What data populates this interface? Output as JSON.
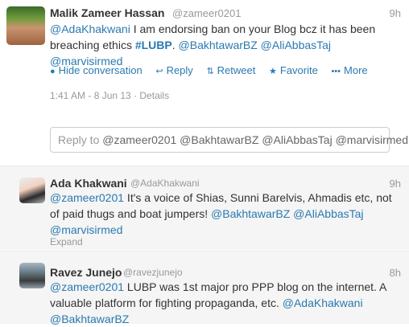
{
  "main_tweet": {
    "name": "Malik Zameer Hassan",
    "handle": "@zameer0201",
    "time": "9h",
    "text": {
      "mention1": "@AdaKhakwani",
      "body1": " I am endorsing ban on your Blog bcz it has been breaching ethics ",
      "hashtag": "#LUBP",
      "body2": ". ",
      "mention2": "@BakhtawarBZ",
      "mention3": "@AliAbbasTaj",
      "mention4": "@marvisirmed"
    },
    "actions": {
      "hide": "Hide conversation",
      "reply": "Reply",
      "retweet": "Retweet",
      "favorite": "Favorite",
      "more": "More"
    },
    "meta": "1:41 AM - 8 Jun 13 · Details"
  },
  "reply_box": {
    "label": "Reply to ",
    "mentions": "@zameer0201 @BakhtawarBZ @AliAbbasTaj @marvisirmed"
  },
  "replies": [
    {
      "name": "Ada Khakwani",
      "handle": "@AdaKhakwani",
      "time": "9h",
      "mention": "@zameer0201",
      "body": " It's a voice of Shias, Sunni Barelvis, Ahmadis etc, not of paid thugs and boat jumpers! ",
      "mention2": "@BakhtawarBZ",
      "mention3": "@AliAbbasTaj",
      "mention4": "@marvisirmed",
      "expand": "Expand"
    },
    {
      "name": "Ravez Junejo",
      "handle": "@ravezjunejo",
      "time": "8h",
      "mention": "@zameer0201",
      "body": " LUBP was 1st major pro PPP blog on the internet. A valuable platform for fighting propaganda, etc. ",
      "mention2": "@AdaKhakwani",
      "mention3": "@BakhtawarBZ"
    }
  ],
  "colors": {
    "link": "#2a7ab0",
    "muted": "#999999",
    "reply_bg": "#f5f5f5"
  }
}
